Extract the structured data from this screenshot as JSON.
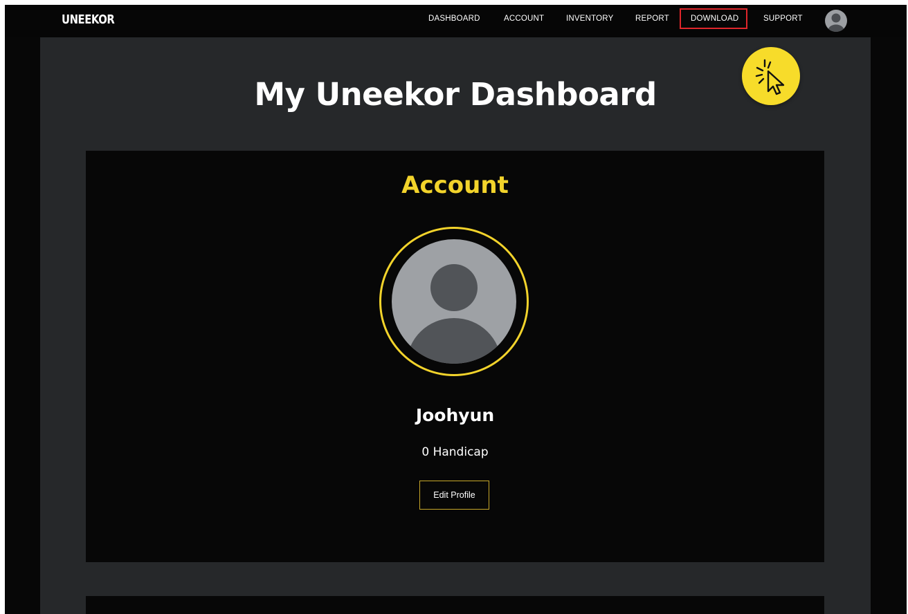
{
  "brand": {
    "logo": "UNEEKOR"
  },
  "nav": {
    "items": [
      {
        "label": "DASHBOARD"
      },
      {
        "label": "ACCOUNT"
      },
      {
        "label": "INVENTORY"
      },
      {
        "label": "REPORT"
      },
      {
        "label": "DOWNLOAD"
      },
      {
        "label": "SUPPORT"
      }
    ],
    "highlighted": "DOWNLOAD"
  },
  "page": {
    "title": "My Uneekor Dashboard"
  },
  "account": {
    "title": "Account",
    "name": "Joohyun",
    "handicap": "0 Handicap",
    "edit_label": "Edit Profile"
  },
  "icons": {
    "top_avatar": "user-avatar-icon",
    "profile_avatar": "user-avatar-icon",
    "click_indicator": "cursor-click-icon"
  },
  "colors": {
    "accent": "#f2d32b",
    "highlight": "#e0262b",
    "panel": "#26282a",
    "card": "#070707"
  }
}
